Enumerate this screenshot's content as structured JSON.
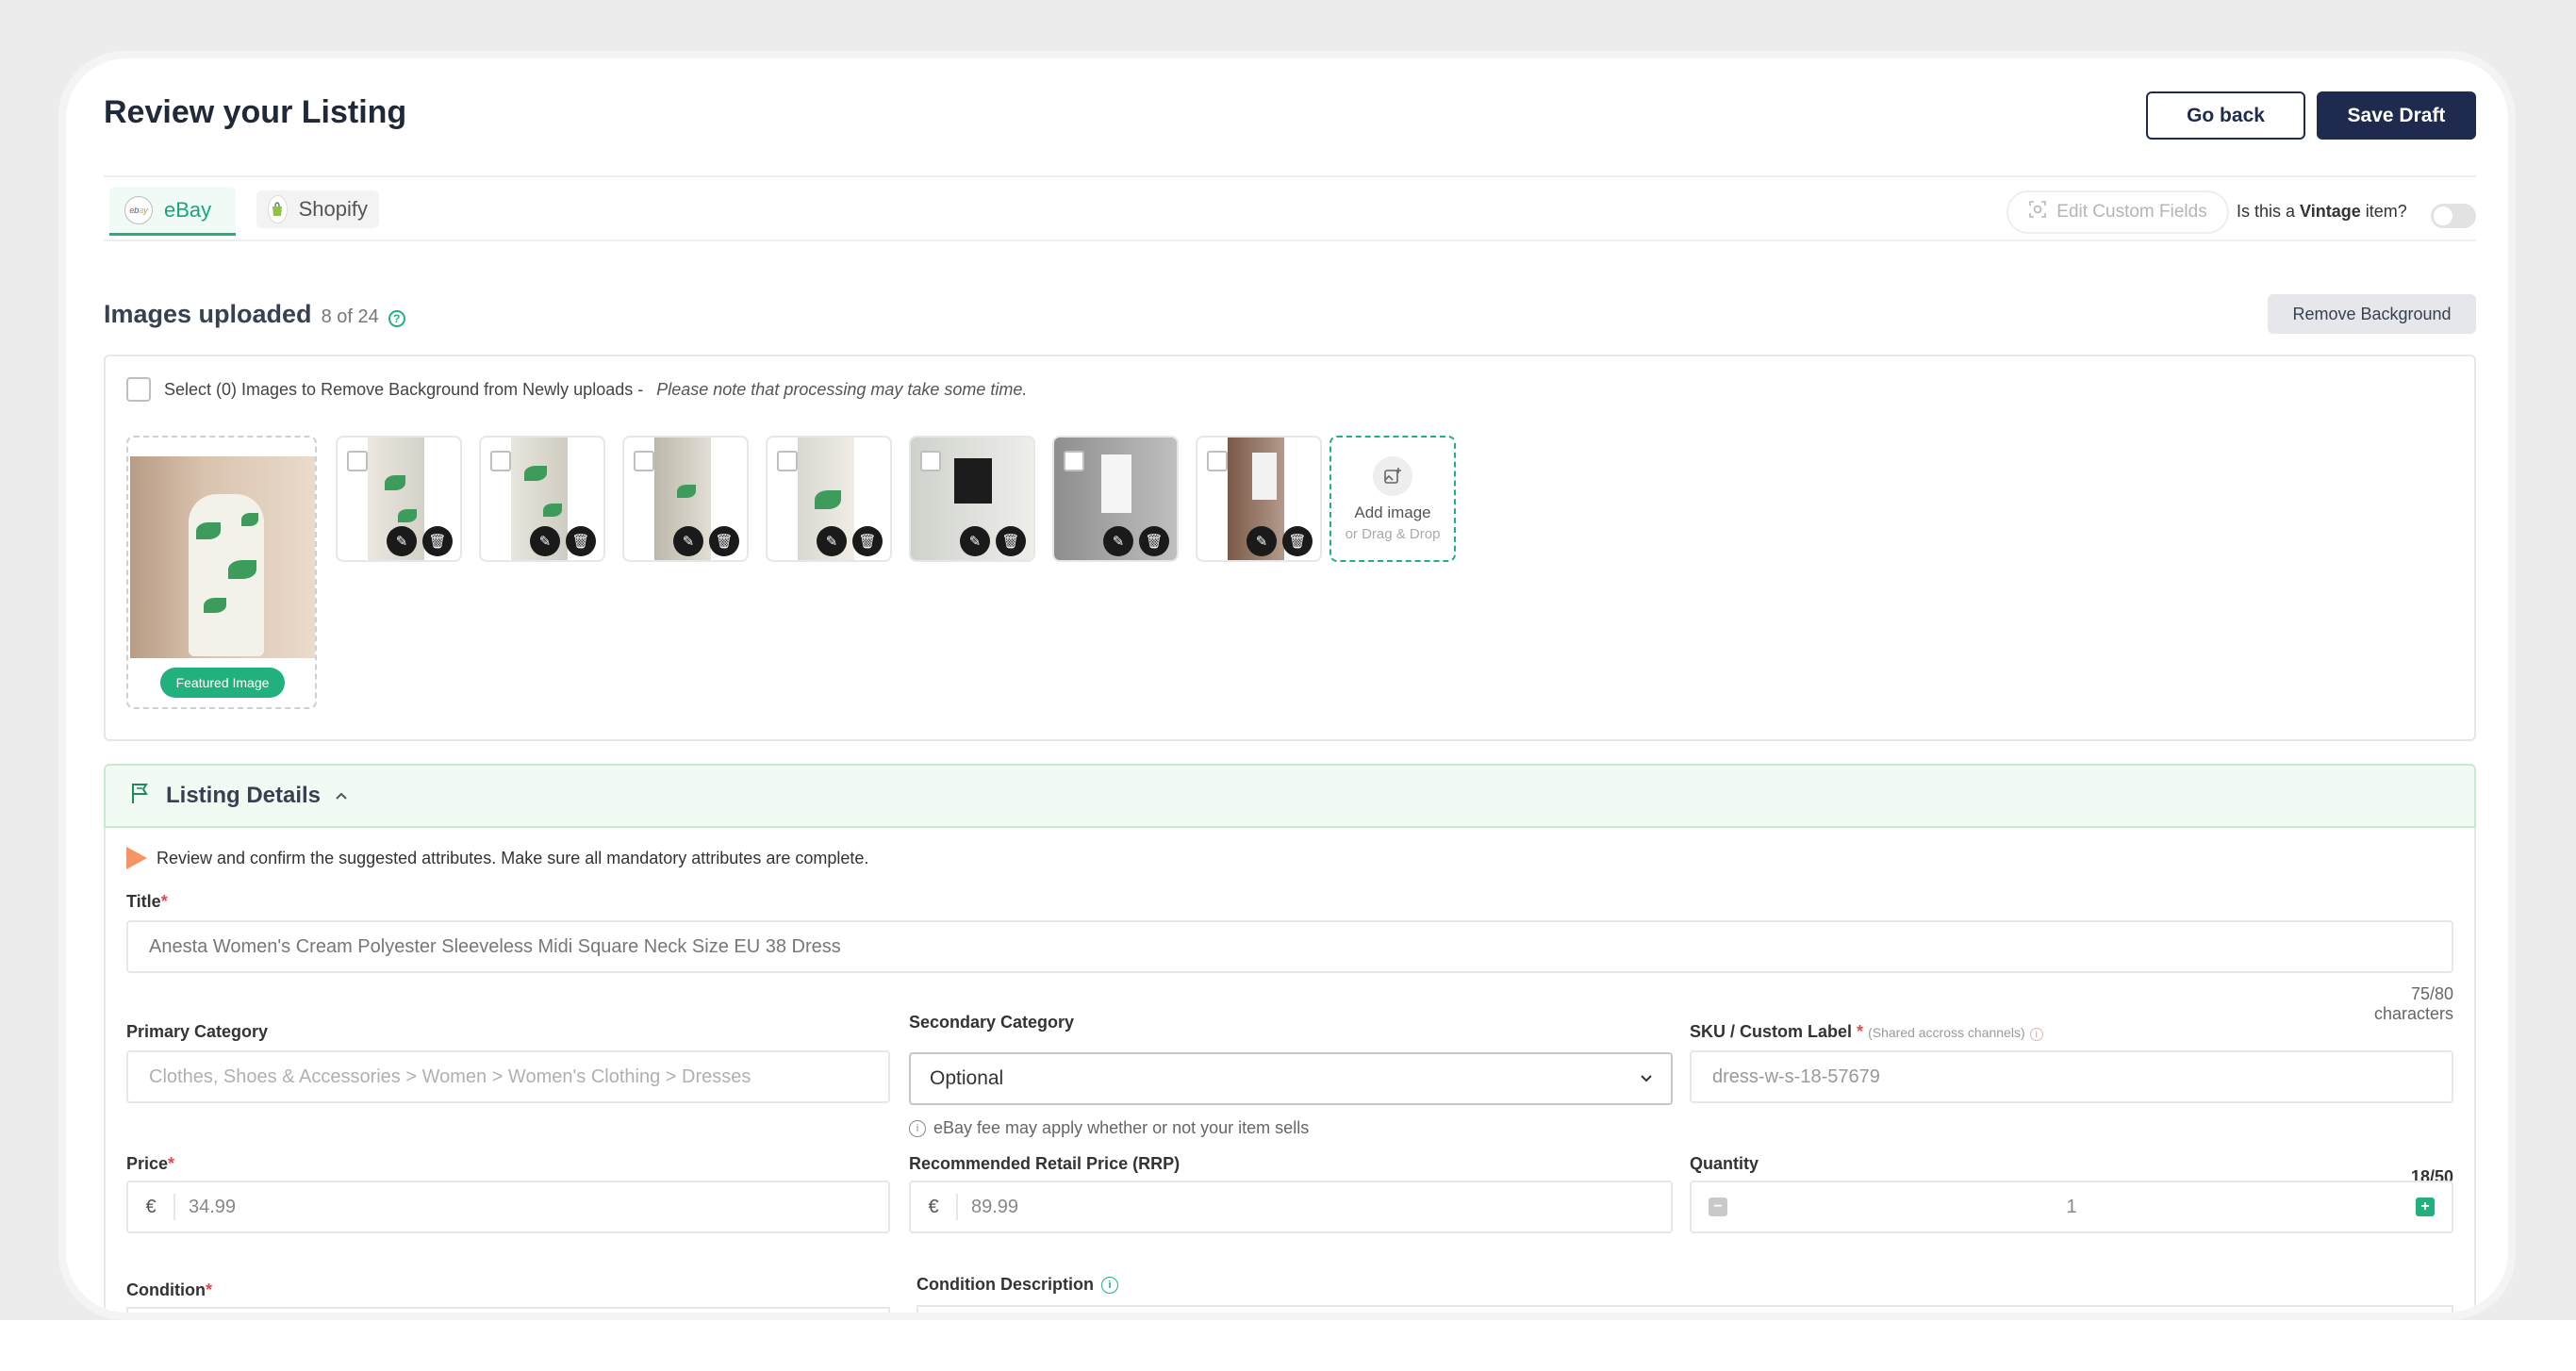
{
  "header": {
    "title": "Review your Listing",
    "go_back": "Go back",
    "save_draft": "Save Draft"
  },
  "tabs": [
    {
      "label": "eBay",
      "logo": "ebay",
      "active": true
    },
    {
      "label": "Shopify",
      "logo": "shopify-bag",
      "active": false
    }
  ],
  "toolbar": {
    "edit_custom_fields": "Edit Custom Fields",
    "vintage_prefix": "Is this a",
    "vintage_bold": "Vintage",
    "vintage_suffix": "item?",
    "vintage_on": false
  },
  "images": {
    "heading": "Images uploaded",
    "count": "8 of 24",
    "remove_bg": "Remove Background",
    "select_text": "Select (0) Images to Remove Background from Newly uploads -",
    "select_note": "Please note that processing may take some time.",
    "featured_label": "Featured Image",
    "add_label": "Add image",
    "add_sub": "or Drag & Drop"
  },
  "details": {
    "heading": "Listing Details",
    "hint": "Review and confirm the suggested attributes. Make sure all mandatory attributes are complete.",
    "title_label": "Title",
    "title_value": "Anesta Women's Cream Polyester Sleeveless Midi Square Neck Size EU 38 Dress",
    "title_count": "75/80 characters",
    "primary_label": "Primary Category",
    "primary_value": "Clothes, Shoes & Accessories > Women > Women's Clothing > Dresses",
    "secondary_label": "Secondary Category",
    "secondary_value": "Optional",
    "fee_note": "eBay fee may apply whether or not your item sells",
    "sku_label": "SKU / Custom Label",
    "sku_note": "(Shared accross channels)",
    "sku_value": "dress-w-s-18-57679",
    "sku_count": "18/50",
    "price_label": "Price",
    "price_currency": "€",
    "price_value": "34.99",
    "rrp_label": "Recommended Retail Price (RRP)",
    "rrp_currency": "€",
    "rrp_value": "89.99",
    "qty_label": "Quantity",
    "qty_value": "1",
    "condition_label": "Condition",
    "condition_desc_label": "Condition Description"
  },
  "colors": {
    "brand_dark": "#1e2b4f",
    "accent_green": "#22b07d",
    "required_red": "#e5484d"
  }
}
